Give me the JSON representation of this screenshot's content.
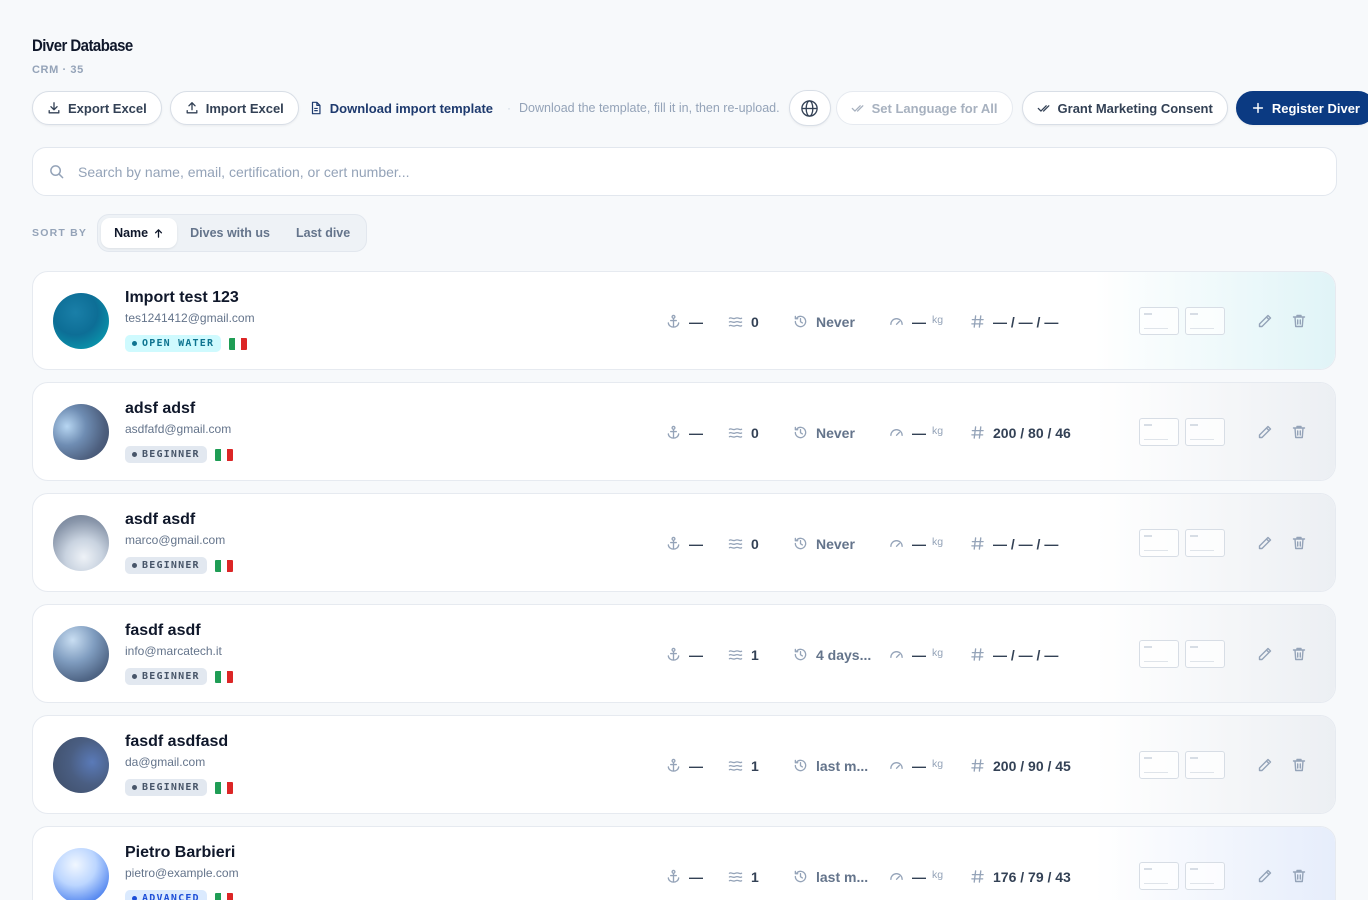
{
  "header": {
    "title": "Diver Database",
    "subtitle": "CRM · 35"
  },
  "toolbar": {
    "export_label": "Export Excel",
    "import_label": "Import Excel",
    "template_label": "Download import template",
    "separator": "·",
    "template_hint": "Download the template, fill it in, then re-upload.",
    "set_language_label": "Set Language for All",
    "consent_label": "Grant Marketing Consent",
    "register_label": "Register Diver"
  },
  "search": {
    "placeholder": "Search by name, email, certification, or cert number..."
  },
  "sort": {
    "label": "SORT BY",
    "options": [
      "Name",
      "Dives with us",
      "Last dive"
    ],
    "active": "Name"
  },
  "colors": {
    "primary": "#0b3a82",
    "open_water_bg": "#cffafe",
    "open_water_fg": "#0e7490",
    "beginner_bg": "#e2e8f0",
    "beginner_fg": "#475569",
    "advanced_bg": "#dbeafe",
    "advanced_fg": "#1d4ed8"
  },
  "divers": [
    {
      "name": "Import test 123",
      "email": "tes1241412@gmail.com",
      "cert": "OPEN WATER",
      "anchor": "—",
      "dives": "0",
      "last_dive": "Never",
      "weight": "—",
      "weight_unit": "kg",
      "numbers": "— / — / —"
    },
    {
      "name": "adsf adsf",
      "email": "asdfafd@gmail.com",
      "cert": "BEGINNER",
      "anchor": "—",
      "dives": "0",
      "last_dive": "Never",
      "weight": "—",
      "weight_unit": "kg",
      "numbers": "200 / 80 / 46"
    },
    {
      "name": "asdf asdf",
      "email": "marco@gmail.com",
      "cert": "BEGINNER",
      "anchor": "—",
      "dives": "0",
      "last_dive": "Never",
      "weight": "—",
      "weight_unit": "kg",
      "numbers": "— / — / —"
    },
    {
      "name": "fasdf asdf",
      "email": "info@marcatech.it",
      "cert": "BEGINNER",
      "anchor": "—",
      "dives": "1",
      "last_dive": "4 days...",
      "weight": "—",
      "weight_unit": "kg",
      "numbers": "— / — / —"
    },
    {
      "name": "fasdf asdfasd",
      "email": "da@gmail.com",
      "cert": "BEGINNER",
      "anchor": "—",
      "dives": "1",
      "last_dive": "last m...",
      "weight": "—",
      "weight_unit": "kg",
      "numbers": "200 / 90 / 45"
    },
    {
      "name": "Pietro Barbieri",
      "email": "pietro@example.com",
      "cert": "ADVANCED",
      "anchor": "—",
      "dives": "1",
      "last_dive": "last m...",
      "weight": "—",
      "weight_unit": "kg",
      "numbers": "176 / 79 / 43"
    }
  ]
}
